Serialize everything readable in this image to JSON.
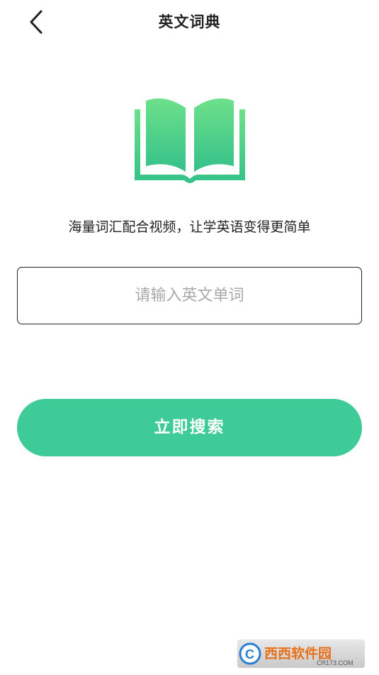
{
  "header": {
    "title": "英文词典",
    "back_icon": "chevron-left-icon"
  },
  "hero": {
    "icon": "open-book-icon",
    "tagline": "海量词汇配合视频，让学英语变得更简单"
  },
  "search": {
    "placeholder": "请输入英文单词",
    "value": ""
  },
  "actions": {
    "search_label": "立即搜索"
  },
  "watermark": {
    "text": "西西软件园",
    "subtext": "CR173.COM"
  },
  "colors": {
    "accent": "#3fcb97",
    "book_light": "#6ee08a",
    "book_dark": "#34c18a",
    "placeholder": "#a9a9a9",
    "text": "#222222"
  }
}
